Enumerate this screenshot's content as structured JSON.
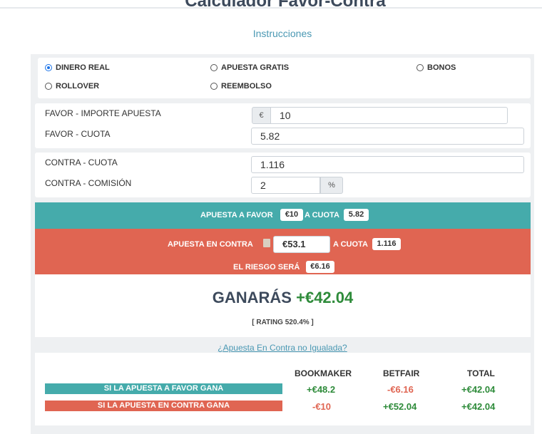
{
  "header": {
    "title": "Calculador Favor-Contra",
    "instructions_link": "Instrucciones"
  },
  "options": {
    "selected": "DINERO REAL",
    "items": [
      "DINERO REAL",
      "APUESTA GRATIS",
      "BONOS",
      "ROLLOVER",
      "REEMBOLSO"
    ]
  },
  "favor": {
    "importe_label": "FAVOR - IMPORTE APUESTA",
    "currency_symbol": "€",
    "importe_value": "10",
    "cuota_label": "FAVOR - CUOTA",
    "cuota_value": "5.82"
  },
  "contra": {
    "cuota_label": "CONTRA - CUOTA",
    "cuota_value": "1.116",
    "comision_label": "CONTRA - COMISIÓN",
    "comision_value": "2",
    "percent_symbol": "%"
  },
  "summary_favor": {
    "prefix": "APUESTA A FAVOR",
    "stake": "€10",
    "mid": "A CUOTA",
    "odds": "5.82"
  },
  "summary_contra": {
    "prefix": "APUESTA EN CONTRA",
    "stake": "€53.1",
    "mid": "A CUOTA",
    "odds": "1.116",
    "risk_label": "EL RIESGO SERÁ",
    "risk": "€6.16"
  },
  "result": {
    "label": "GANARÁS",
    "amount": "+€42.04",
    "rating": "[ RATING 520.4% ]"
  },
  "unmatched_link": "¿Apuesta En Contra no Igualada?",
  "table": {
    "columns": [
      "BOOKMAKER",
      "BETFAIR",
      "TOTAL"
    ],
    "rows": [
      {
        "label": "SI LA APUESTA A FAVOR GANA",
        "bookmaker": "+€48.2",
        "betfair": "-€6.16",
        "total": "+€42.04"
      },
      {
        "label": "SI LA APUESTA EN CONTRA GANA",
        "bookmaker": "-€10",
        "betfair": "+€52.04",
        "total": "+€42.04"
      }
    ]
  },
  "colors": {
    "teal": "#45abab",
    "red": "#e06552",
    "green": "#2e8b3a",
    "title": "#3d4a5c",
    "link": "#4a98b3"
  }
}
